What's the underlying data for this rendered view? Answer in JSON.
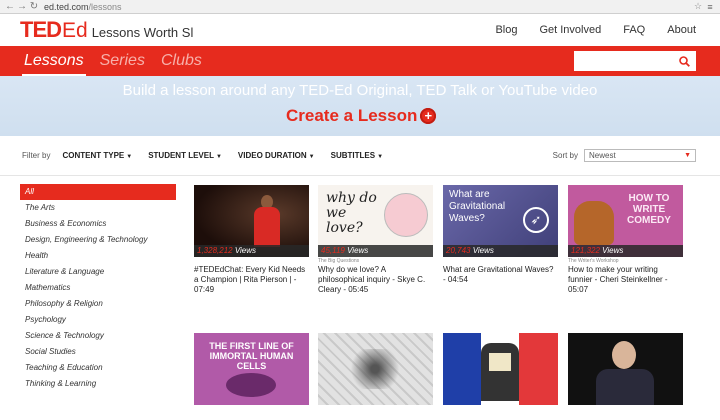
{
  "browser": {
    "url_host": "ed.ted.com",
    "url_path": "/lessons"
  },
  "header": {
    "logo_ted": "TED",
    "logo_ed": "Ed",
    "tagline": "Lessons Worth Sl",
    "links": [
      "Blog",
      "Get Involved",
      "FAQ",
      "About"
    ]
  },
  "nav": {
    "tabs": [
      "Lessons",
      "Series",
      "Clubs"
    ],
    "active_tab": "Lessons",
    "search_value": ""
  },
  "banner": {
    "headline": "Build a lesson around any TED-Ed Original, TED Talk or YouTube video",
    "cta": "Create a Lesson"
  },
  "filters": {
    "label": "Filter by",
    "items": [
      "CONTENT TYPE",
      "STUDENT LEVEL",
      "VIDEO DURATION",
      "SUBTITLES"
    ],
    "sort_label": "Sort by",
    "sort_value": "Newest"
  },
  "sidebar": {
    "items": [
      "All",
      "The Arts",
      "Business & Economics",
      "Design, Engineering & Technology",
      "Health",
      "Literature & Language",
      "Mathematics",
      "Philosophy & Religion",
      "Psychology",
      "Science & Technology",
      "Social Studies",
      "Teaching & Education",
      "Thinking & Learning"
    ],
    "active": "All"
  },
  "cards": [
    {
      "views_num": "1,328,212",
      "views_label": "Views",
      "series": "",
      "title": "#TEDEdChat: Every Kid Needs a Champion | Rita Pierson | - 07:49"
    },
    {
      "views_num": "45,119",
      "views_label": "Views",
      "series": "The Big Questions",
      "title": "Why do we love? A philosophical inquiry - Skye C. Cleary - 05:45"
    },
    {
      "views_num": "20,743",
      "views_label": "Views",
      "series": "",
      "title": "What are Gravitational Waves? - 04:54"
    },
    {
      "views_num": "121,322",
      "views_label": "Views",
      "series": "The Writer's Workshop",
      "title": "How to make your writing funnier - Cheri Steinkellner - 05:07"
    }
  ],
  "thumb_text": {
    "t2": "why do we love?",
    "t3": "What are Gravitational Waves?",
    "t4": "HOW TO WRITE COMEDY",
    "t5": "THE FIRST LINE OF IMMORTAL HUMAN CELLS"
  },
  "colors": {
    "brand_red": "#e62b1e",
    "banner_blue": "#d4e3f2"
  }
}
